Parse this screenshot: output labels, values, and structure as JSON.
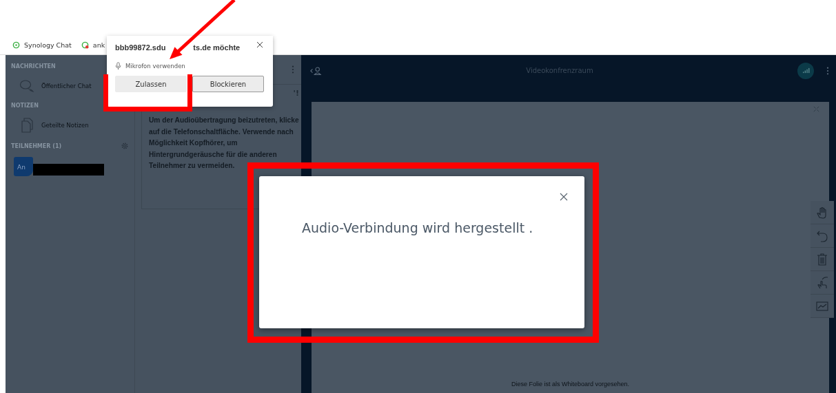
{
  "bookmarks": [
    {
      "label": "Synology Chat",
      "kind": "chat"
    },
    {
      "label": "ank",
      "kind": "alert"
    }
  ],
  "permission_popup": {
    "title": [
      "bbb99872.sdu",
      "ts.de möchte"
    ],
    "request": "Mikrofon verwenden",
    "buttons": [
      {
        "label": "Zulassen",
        "selected": true
      },
      {
        "label": "Blockieren",
        "selected": false
      }
    ]
  },
  "sidebar": {
    "sections": [
      {
        "heading": "NACHRICHTEN",
        "items": [
          {
            "label": "Öffentlicher Chat",
            "kind": "chat"
          }
        ]
      },
      {
        "heading": "NOTIZEN",
        "items": [
          {
            "label": "Geteilte Notizen",
            "kind": "notes"
          }
        ]
      }
    ],
    "participants": {
      "heading": "TEILNEHMER (1)",
      "users": [
        {
          "initials": "An"
        }
      ]
    }
  },
  "chat": {
    "heading_tail": "'!",
    "message": "Um der Audioübertragung beizutreten, klicke auf die Telefonschaltfläche. Verwende nach Möglichkeit Kopfhörer, um Hintergrundgeräusche für die anderen Teilnehmer zu vermeiden."
  },
  "main": {
    "title": "Videokonfrenzraum",
    "footer": "Diese Folie ist als Whiteboard vorgesehen."
  },
  "modal": {
    "message": "Audio-Verbindung wird hergestellt ."
  }
}
